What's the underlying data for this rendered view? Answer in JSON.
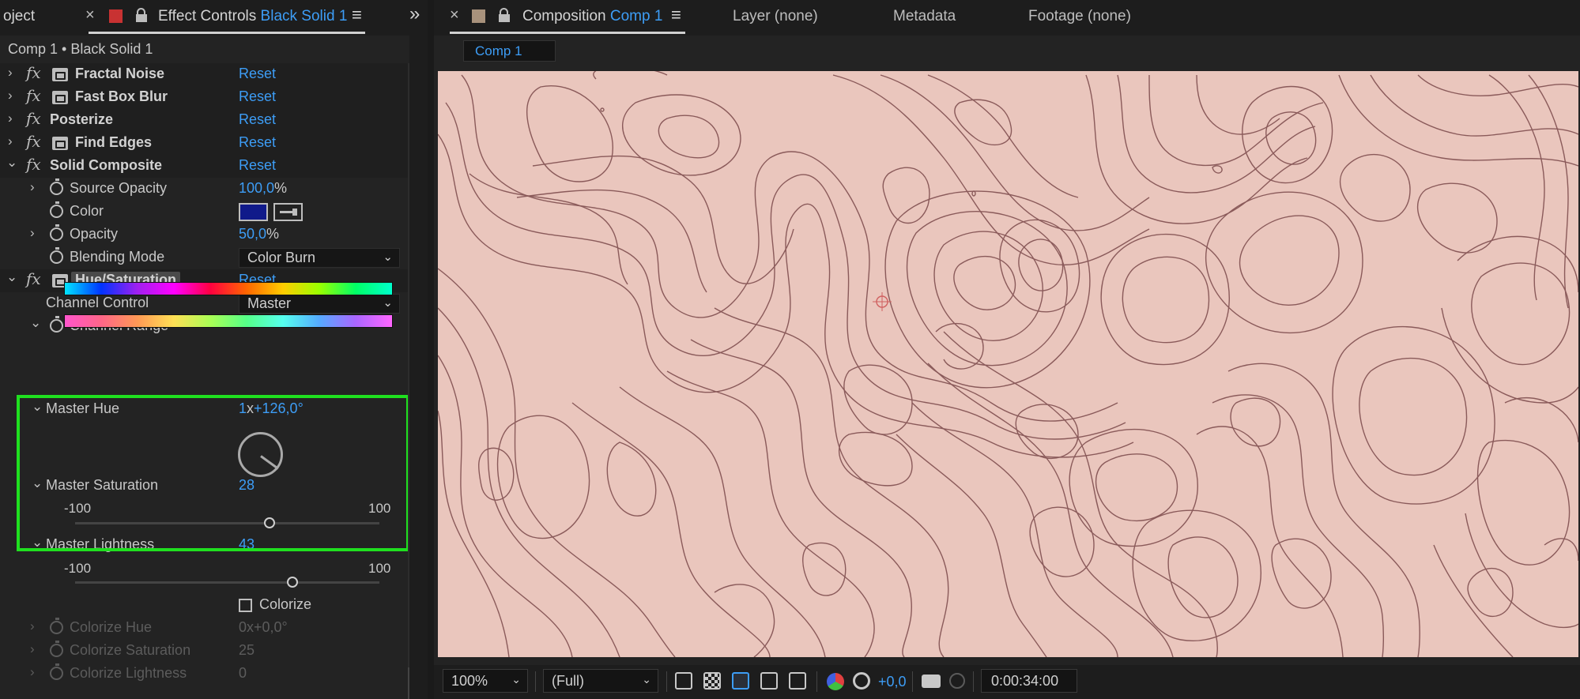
{
  "left_panel": {
    "project_tab_label": "oject",
    "effect_controls_tab": {
      "label": "Effect Controls",
      "layer": "Black Solid 1"
    },
    "breadcrumb": "Comp 1 • Black Solid 1",
    "reset_label": "Reset",
    "effects": [
      {
        "name": "Fractal Noise"
      },
      {
        "name": "Fast Box Blur"
      },
      {
        "name": "Posterize"
      },
      {
        "name": "Find Edges"
      },
      {
        "name": "Solid Composite"
      }
    ],
    "solid_composite_props": {
      "source_opacity": {
        "label": "Source Opacity",
        "value": "100,0",
        "unit": "%"
      },
      "color": {
        "label": "Color",
        "swatch": "#101a8a"
      },
      "opacity": {
        "label": "Opacity",
        "value": "50,0",
        "unit": "%"
      },
      "blending_mode": {
        "label": "Blending Mode",
        "value": "Color Burn"
      }
    },
    "hue_saturation": {
      "name": "Hue/Saturation",
      "channel_control": {
        "label": "Channel Control",
        "value": "Master"
      },
      "channel_range_label": "Channel Range",
      "master_hue": {
        "label": "Master Hue",
        "revolutions": "1",
        "x_sep": "x",
        "degrees": "+126,0°",
        "angle_deg": 126
      },
      "master_saturation": {
        "label": "Master Saturation",
        "value": "28",
        "min": "-100",
        "max": "100",
        "value_num": 28
      },
      "master_lightness": {
        "label": "Master Lightness",
        "value": "43",
        "min": "-100",
        "max": "100",
        "value_num": 43
      },
      "colorize_label": "Colorize",
      "colorize_hue": {
        "label": "Colorize Hue",
        "value": "0x+0,0°"
      },
      "colorize_saturation": {
        "label": "Colorize Saturation",
        "value": "25"
      },
      "colorize_lightness": {
        "label": "Colorize Lightness",
        "value": "0"
      }
    }
  },
  "right_panel": {
    "composition_tab": {
      "label": "Composition",
      "comp": "Comp 1"
    },
    "layer_tab": "Layer (none)",
    "metadata_tab": "Metadata",
    "footage_tab": "Footage (none)",
    "comp_chip": "Comp 1",
    "viewer_background": "#eac6bd",
    "contour_color": "#8a5a5a",
    "bottom_bar": {
      "zoom": "100%",
      "resolution": "(Full)",
      "exposure": "+0,0",
      "timecode": "0:00:34:00"
    }
  },
  "icons": {
    "close": "×",
    "menu": "≡",
    "lock": "lock-icon",
    "chevron_right": "›",
    "chevron_down": "⌄",
    "more": "»"
  },
  "colors": {
    "accent_blue": "#3d9df6",
    "highlight_box": "#1fe01f",
    "effect_controls_swatch": "#c83232",
    "composition_swatch": "#a8927c"
  }
}
